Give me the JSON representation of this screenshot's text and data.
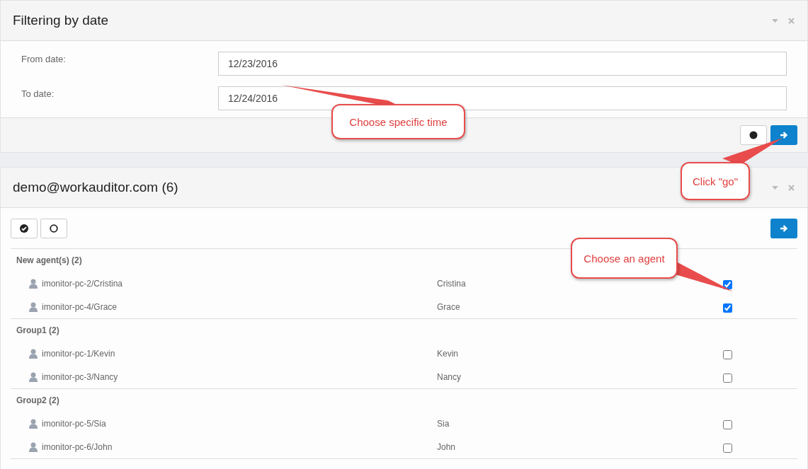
{
  "filter_panel": {
    "title": "Filtering by date",
    "fields": [
      {
        "label": "From date:",
        "value": "12/23/2016"
      },
      {
        "label": "To date:",
        "value": "12/24/2016"
      }
    ]
  },
  "agents_panel": {
    "title": "demo@workauditor.com (6)",
    "groups": [
      {
        "name": "New agent(s) (2)",
        "agents": [
          {
            "computer": "imonitor-pc-2/Cristina",
            "user": "Cristina",
            "checked": true
          },
          {
            "computer": "imonitor-pc-4/Grace",
            "user": "Grace",
            "checked": true
          }
        ]
      },
      {
        "name": "Group1 (2)",
        "agents": [
          {
            "computer": "imonitor-pc-1/Kevin",
            "user": "Kevin",
            "checked": false
          },
          {
            "computer": "imonitor-pc-3/Nancy",
            "user": "Nancy",
            "checked": false
          }
        ]
      },
      {
        "name": "Group2 (2)",
        "agents": [
          {
            "computer": "imonitor-pc-5/Sia",
            "user": "Sia",
            "checked": false
          },
          {
            "computer": "imonitor-pc-6/John",
            "user": "John",
            "checked": false
          }
        ]
      }
    ]
  },
  "callouts": [
    {
      "text": "Choose specific time"
    },
    {
      "text": "Click \"go\""
    },
    {
      "text": "Choose an agent"
    }
  ]
}
